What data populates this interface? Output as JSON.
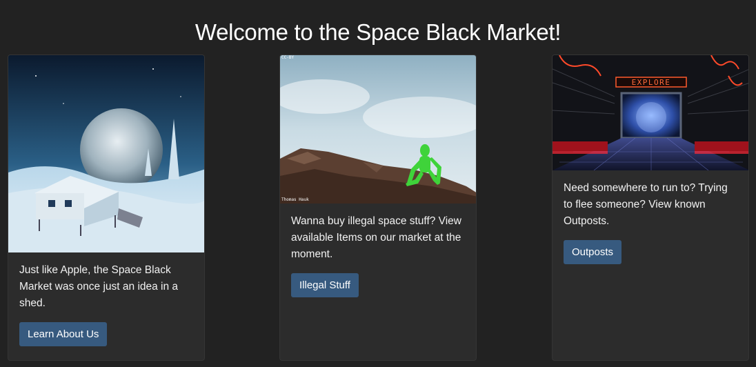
{
  "page": {
    "title": "Welcome to the Space Black Market!"
  },
  "cards": [
    {
      "image_alt": "snowy moon outpost with hut",
      "text": "Just like Apple, the Space Black Market was once just an idea in a shed.",
      "button": "Learn About Us"
    },
    {
      "image_alt": "green alien figure on rocks",
      "image_credit": "Thomas Hauk",
      "image_badge": "CC-BY",
      "text": "Wanna buy illegal space stuff? View available Items on our market at the moment.",
      "button": "Illegal Stuff"
    },
    {
      "image_alt": "sci-fi corridor with explore sign",
      "image_sign": "EXPLORE",
      "text": "Need somewhere to run to? Trying to flee someone? View known Outposts.",
      "button": "Outposts"
    }
  ],
  "colors": {
    "background": "#222222",
    "card": "#2c2c2c",
    "button": "#375a7f"
  }
}
